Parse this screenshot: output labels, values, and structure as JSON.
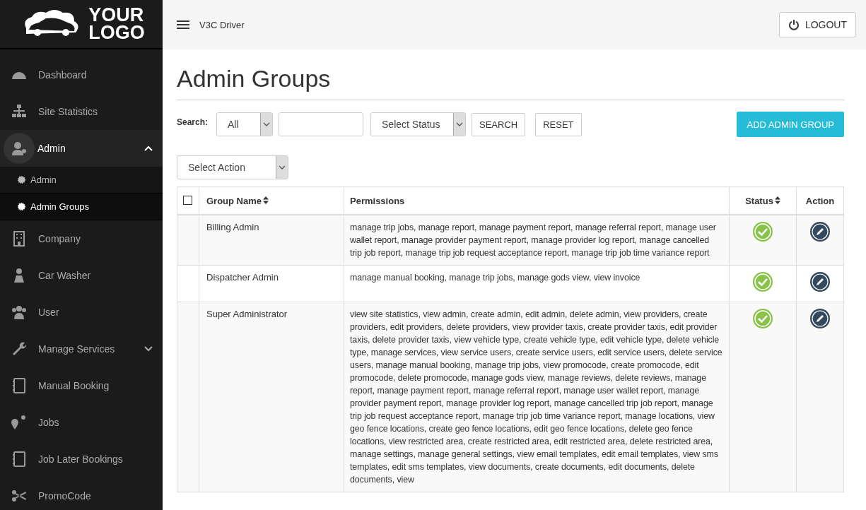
{
  "sidebar": {
    "logo": {
      "line1": "YOUR",
      "line2": "LOGO"
    },
    "items": [
      {
        "label": "Dashboard",
        "kind": "link",
        "selected": false
      },
      {
        "label": "Site Statistics",
        "kind": "link",
        "selected": false
      },
      {
        "label": "Admin",
        "kind": "group",
        "selected": true,
        "expanded": true,
        "children": [
          {
            "label": "Admin",
            "selected": false
          },
          {
            "label": "Admin Groups",
            "selected": true
          }
        ]
      },
      {
        "label": "Company",
        "kind": "link",
        "selected": false
      },
      {
        "label": "Car Washer",
        "kind": "link",
        "selected": false
      },
      {
        "label": "User",
        "kind": "link",
        "selected": false
      },
      {
        "label": "Manage Services",
        "kind": "group",
        "selected": false,
        "expanded": false
      },
      {
        "label": "Manual Booking",
        "kind": "link",
        "selected": false
      },
      {
        "label": "Jobs",
        "kind": "link",
        "selected": false
      },
      {
        "label": "Job Later Bookings",
        "kind": "link",
        "selected": false
      },
      {
        "label": "PromoCode",
        "kind": "link",
        "selected": false
      }
    ]
  },
  "header": {
    "title": "V3C Driver",
    "logout": "LOGOUT"
  },
  "page_title": "Admin Groups",
  "filters": {
    "label": "Search:",
    "field_select": "All",
    "status_select": "Select Status",
    "search_button": "SEARCH",
    "reset_button": "RESET",
    "add_button": "ADD ADMIN GROUP",
    "action_select": "Select Action"
  },
  "table": {
    "select_all_checked": false,
    "columns": [
      {
        "label": "Group Name",
        "sortable": true
      },
      {
        "label": "Permissions",
        "sortable": false
      },
      {
        "label": "Status",
        "sortable": true
      },
      {
        "label": "Action",
        "sortable": false
      }
    ],
    "rows": [
      {
        "name": "Billing Admin",
        "permissions": "manage trip jobs, manage report, manage payment report, manage referral report, manage user wallet report, manage provider payment report, manage provider log report, manage cancelled trip job report, manage trip job request acceptance report, manage trip job time variance report",
        "active": true
      },
      {
        "name": "Dispatcher Admin",
        "permissions": "manage manual booking, manage trip jobs, manage gods view, view invoice",
        "active": true
      },
      {
        "name": "Super Administrator",
        "permissions": "view site statistics, view admin, create admin, edit admin, delete admin, view providers, create providers, edit providers, delete providers, view provider taxis, create provider taxis, edit provider taxis, delete provider taxis, view vehicle type, create vehicle type, edit vehicle type, delete vehicle type, manage services, view service users, create service users, edit service users, delete service users, manage manual booking, manage trip jobs, view promocode, create promocode, edit promocode, delete promocode, manage gods view, manage reviews, delete reviews, manage report, manage payment report, manage referral report, manage user wallet report, manage provider payment report, manage provider log report, manage cancelled trip job report, manage trip job request acceptance report, manage trip job time variance report, manage locations, view geo fence locations, create geo fence locations, edit geo fence locations, delete geo fence locations, view restricted area, create restricted area, edit restricted area, delete restricted area, manage settings, manage general settings, view email templates, edit email templates, view sms templates, edit sms templates, view documents, create documents, edit documents, delete documents, view",
        "active": true
      }
    ]
  }
}
